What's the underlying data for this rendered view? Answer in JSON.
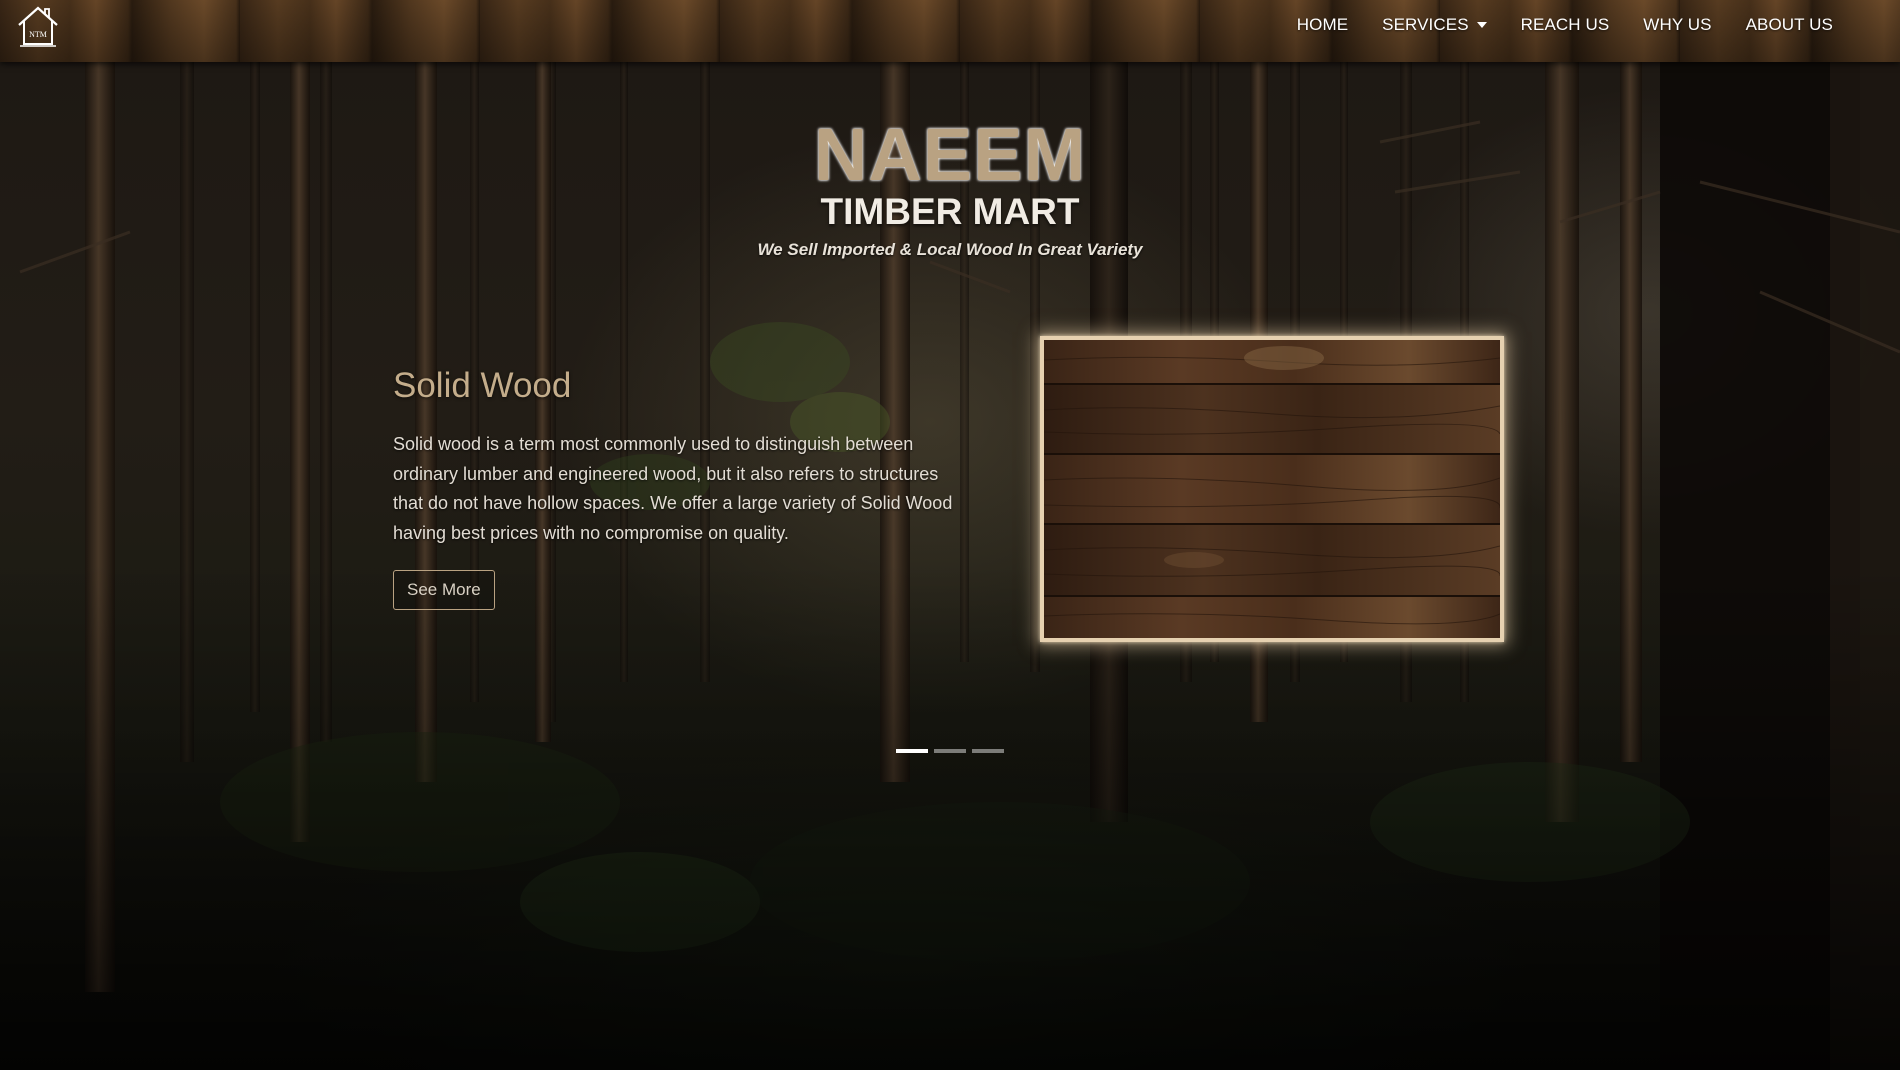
{
  "nav": {
    "logo_text": "NTM",
    "items": [
      {
        "label": "HOME"
      },
      {
        "label": "SERVICES",
        "has_dropdown": true
      },
      {
        "label": "REACH US"
      },
      {
        "label": "WHY US"
      },
      {
        "label": "ABOUT US"
      }
    ]
  },
  "brand": {
    "name": "NAEEM",
    "subtitle": "TIMBER MART",
    "tagline": "We Sell Imported & Local Wood In Great Variety"
  },
  "slide": {
    "title": "Solid Wood",
    "description": "Solid wood is a term most commonly used to distinguish between ordinary lumber and engineered wood, but it also refers to structures that do not have hollow spaces. We offer a large variety of Solid Wood having best prices with no compromise on quality.",
    "button_label": "See More"
  },
  "carousel": {
    "slide_count": 3,
    "active_index": 0
  },
  "colors": {
    "brand_accent": "#b9a282",
    "indicator_active": "#ffffff"
  },
  "icons": {
    "logo": "house-icon"
  }
}
